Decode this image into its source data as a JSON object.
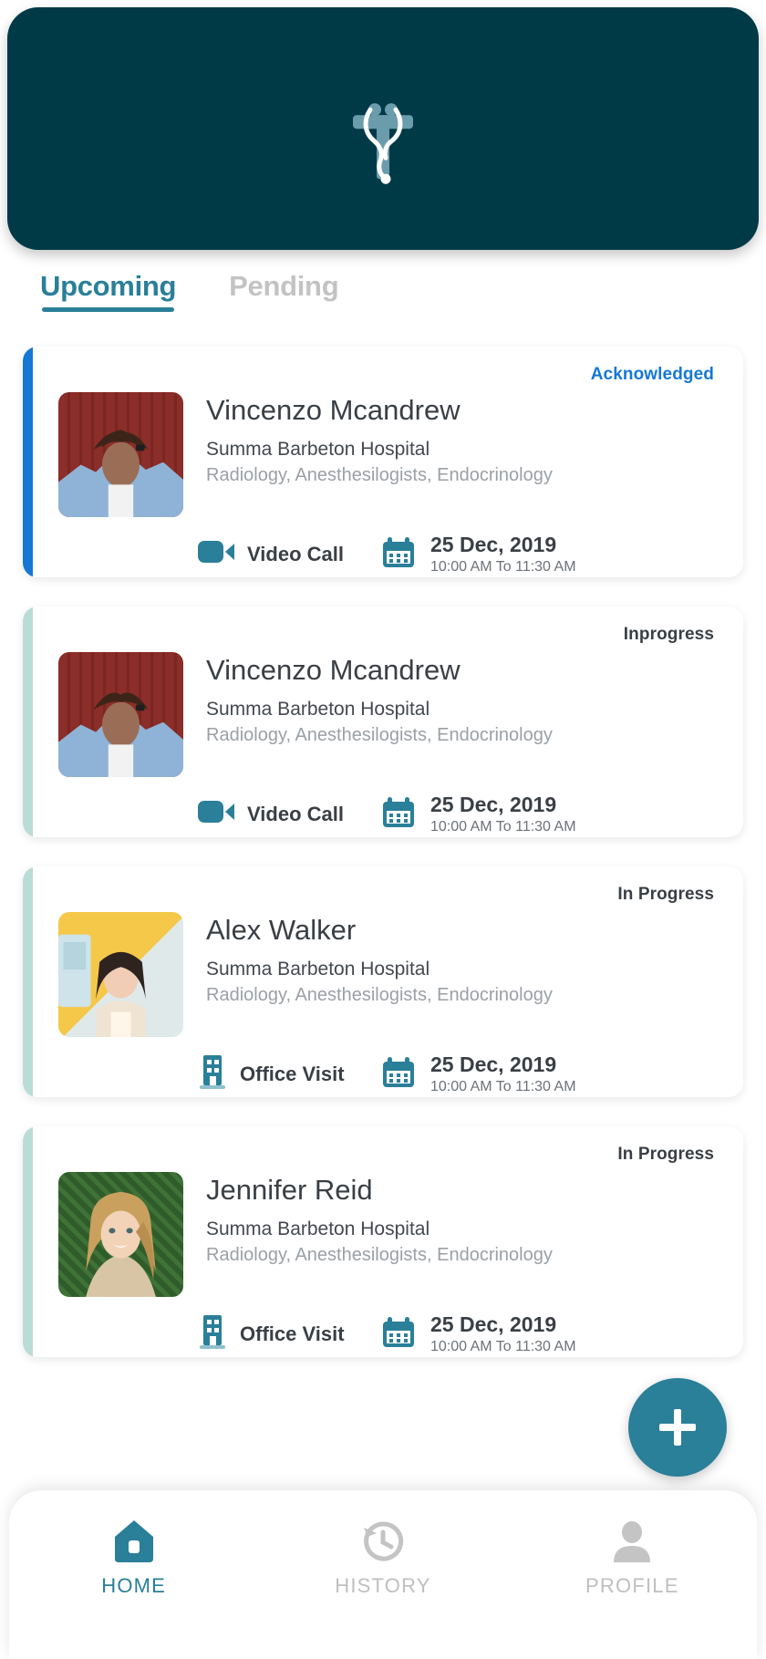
{
  "theme": {
    "header_bg": "#013a47",
    "accent_teal": "#2a7f99",
    "blue_status": "#1578d4",
    "dark_text": "#3a3f45",
    "muted_text": "#9ba0a6",
    "inactive_grey": "#bfbfbf"
  },
  "header": {
    "logo_icon": "stethoscope-cross-logo"
  },
  "tabs": [
    {
      "label": "Upcoming",
      "active": true
    },
    {
      "label": "Pending",
      "active": false
    }
  ],
  "appointments": [
    {
      "status": "Acknowledged",
      "status_color": "#1578d4",
      "accent_color": "#1578d4",
      "name": "Vincenzo Mcandrew",
      "hospital": "Summa Barbeton Hospital",
      "specialties": "Radiology, Anesthesilogists, Endocrinology",
      "mode": "Video Call",
      "mode_icon": "video-call-icon",
      "date": "25 Dec, 2019",
      "time": "10:00 AM To 11:30 AM",
      "avatar": "patient-photo-red-wall"
    },
    {
      "status": "Inprogress",
      "status_color": "#3a3f45",
      "accent_color": "#b9ddd6",
      "name": "Vincenzo Mcandrew",
      "hospital": "Summa Barbeton Hospital",
      "specialties": "Radiology, Anesthesilogists, Endocrinology",
      "mode": "Video Call",
      "mode_icon": "video-call-icon",
      "date": "25 Dec, 2019",
      "time": "10:00 AM To 11:30 AM",
      "avatar": "patient-photo-red-wall"
    },
    {
      "status": "In Progress",
      "status_color": "#3a3f45",
      "accent_color": "#b9ddd6",
      "name": "Alex Walker",
      "hospital": "Summa Barbeton Hospital",
      "specialties": "Radiology, Anesthesilogists, Endocrinology",
      "mode": "Office Visit",
      "mode_icon": "office-building-icon",
      "date": "25 Dec, 2019",
      "time": "10:00 AM To 11:30 AM",
      "avatar": "patient-photo-yellow-wall"
    },
    {
      "status": "In Progress",
      "status_color": "#3a3f45",
      "accent_color": "#b9ddd6",
      "name": "Jennifer Reid",
      "hospital": "Summa Barbeton Hospital",
      "specialties": "Radiology, Anesthesilogists, Endocrinology",
      "mode": "Office Visit",
      "mode_icon": "office-building-icon",
      "date": "25 Dec, 2019",
      "time": "10:00 AM To 11:30 AM",
      "avatar": "patient-photo-green-hedge"
    }
  ],
  "fab": {
    "label": "+",
    "icon": "plus-icon"
  },
  "bottom_nav": [
    {
      "label": "HOME",
      "icon": "home-icon",
      "active": true
    },
    {
      "label": "HISTORY",
      "icon": "history-clock-icon",
      "active": false
    },
    {
      "label": "PROFILE",
      "icon": "person-icon",
      "active": false
    }
  ]
}
